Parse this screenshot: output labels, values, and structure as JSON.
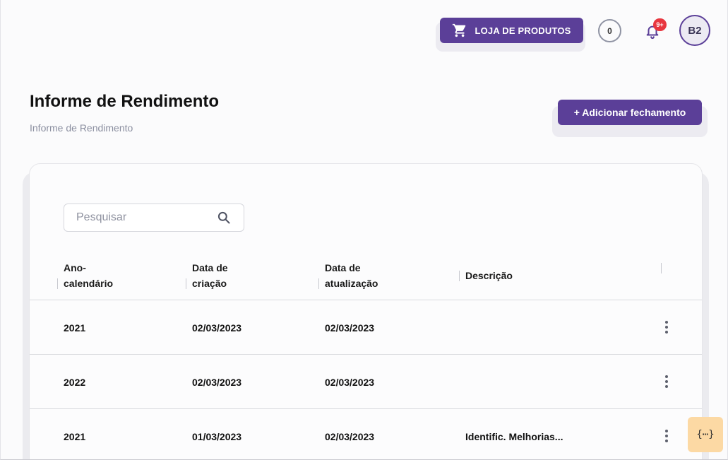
{
  "header": {
    "store_button_label": "LOJA DE PRODUTOS",
    "store_icon": "shopping-cart-icon",
    "counter_value": "0",
    "notification_badge": "9+",
    "avatar_initials": "B2"
  },
  "page": {
    "title": "Informe de Rendimento",
    "breadcrumb": "Informe de Rendimento",
    "add_button_label": "+ Adicionar fechamento"
  },
  "search": {
    "placeholder": "Pesquisar"
  },
  "table": {
    "columns": {
      "ano_line1": "Ano-",
      "ano_line2": "calendário",
      "criacao_line1": "Data de",
      "criacao_line2": "criação",
      "atualizacao_line1": "Data de",
      "atualizacao_line2": "atualização",
      "descricao": "Descrição"
    },
    "rows": [
      {
        "ano": "2021",
        "criacao": "02/03/2023",
        "atualizacao": "02/03/2023",
        "descricao": ""
      },
      {
        "ano": "2022",
        "criacao": "02/03/2023",
        "atualizacao": "02/03/2023",
        "descricao": ""
      },
      {
        "ano": "2021",
        "criacao": "01/03/2023",
        "atualizacao": "02/03/2023",
        "descricao": "Identific. Melhorias..."
      }
    ]
  },
  "dev_tool": {
    "label": "{⋯}"
  },
  "colors": {
    "primary": "#5b3f98",
    "badge_red": "#e8363f",
    "dev_tool_bg": "#fcd9a4"
  }
}
